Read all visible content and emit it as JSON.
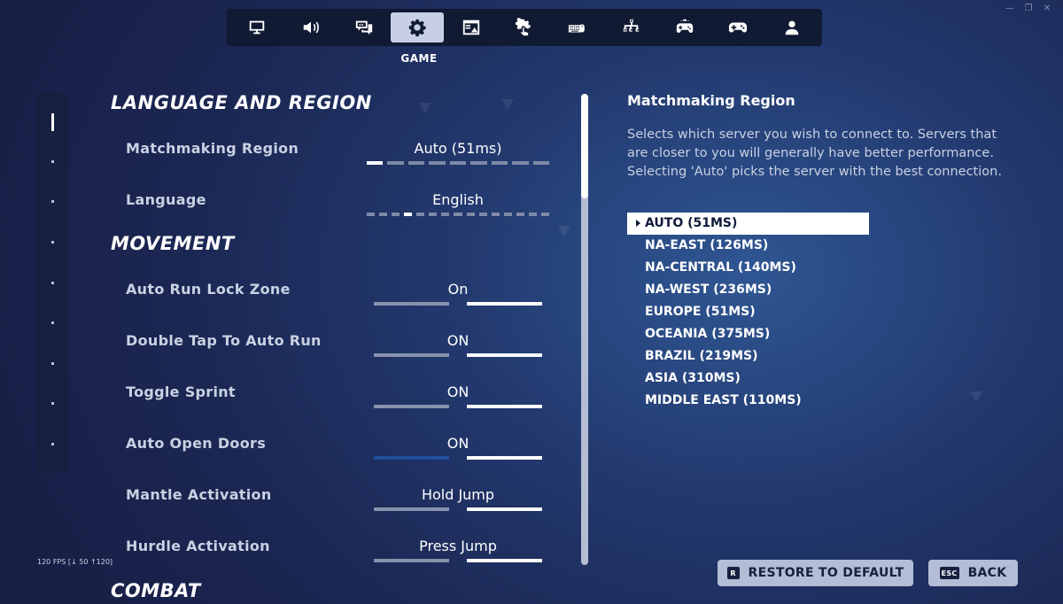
{
  "window": {
    "minimize": "—",
    "maximize": "❐",
    "close": "✕"
  },
  "tabs": [
    {
      "icon": "monitor-icon",
      "active": false
    },
    {
      "icon": "speaker-icon",
      "active": false
    },
    {
      "icon": "chat-icon",
      "active": false
    },
    {
      "icon": "gear-icon",
      "active": true
    },
    {
      "icon": "hud-icon",
      "active": false
    },
    {
      "icon": "touch-gear-icon",
      "active": false
    },
    {
      "icon": "keyboard-mouse-icon",
      "active": false
    },
    {
      "icon": "network-icon",
      "active": false
    },
    {
      "icon": "controller-gear-icon",
      "active": false
    },
    {
      "icon": "controller-icon",
      "active": false
    },
    {
      "icon": "account-icon",
      "active": false
    }
  ],
  "active_tab_caption": "GAME",
  "sections": {
    "language_region": "LANGUAGE AND REGION",
    "movement": "MOVEMENT",
    "combat": "COMBAT"
  },
  "settings": {
    "matchmaking_region": {
      "label": "Matchmaking Region",
      "value": "Auto (51ms)",
      "options_count": 9,
      "selected_index": 0
    },
    "language": {
      "label": "Language",
      "value": "English",
      "options_count": 15,
      "selected_index": 3
    },
    "auto_run_lock_zone": {
      "label": "Auto Run Lock Zone",
      "value": "On"
    },
    "double_tap_auto_run": {
      "label": "Double Tap To Auto Run",
      "value": "ON"
    },
    "toggle_sprint": {
      "label": "Toggle Sprint",
      "value": "ON"
    },
    "auto_open_doors": {
      "label": "Auto Open Doors",
      "value": "ON"
    },
    "mantle_activation": {
      "label": "Mantle Activation",
      "value": "Hold Jump"
    },
    "hurdle_activation": {
      "label": "Hurdle Activation",
      "value": "Press Jump"
    }
  },
  "info": {
    "title": "Matchmaking Region",
    "description": "Selects which server you wish to connect to. Servers that are closer to you will generally have better performance. Selecting 'Auto' picks the server with the best connection."
  },
  "regions": [
    "AUTO (51MS)",
    "NA-EAST (126MS)",
    "NA-CENTRAL (140MS)",
    "NA-WEST (236MS)",
    "EUROPE (51MS)",
    "OCEANIA (375MS)",
    "BRAZIL (219MS)",
    "ASIA (310MS)",
    "MIDDLE EAST (110MS)"
  ],
  "buttons": {
    "restore_key": "R",
    "restore_label": "RESTORE TO DEFAULT",
    "back_key": "ESC",
    "back_label": "BACK"
  },
  "fps_readout": "120 FPS [↓ 50 ↑120]",
  "colors": {
    "accent_active_tab": "#c6cfe6",
    "panel_dark": "#16203f",
    "toggle_blue": "#1f4f9c"
  }
}
